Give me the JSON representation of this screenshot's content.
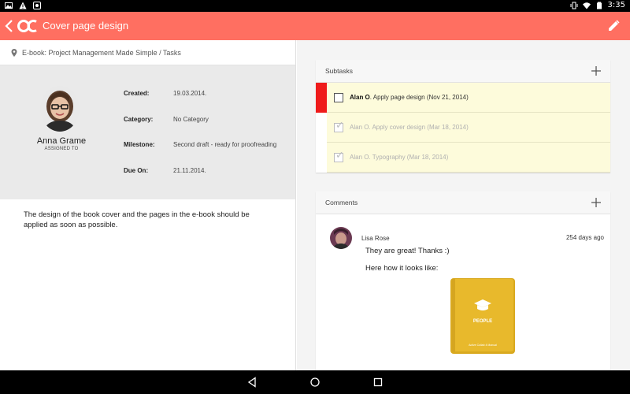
{
  "status_bar": {
    "time": "3:35"
  },
  "app_bar": {
    "title": "Cover page design"
  },
  "breadcrumb": {
    "text": "E-book: Project Management Made Simple / Tasks"
  },
  "assignee": {
    "name": "Anna Grame",
    "role": "ASSIGNED TO"
  },
  "fields": {
    "created_label": "Created:",
    "created_value": "19.03.2014.",
    "category_label": "Category:",
    "category_value": "No Category",
    "milestone_label": "Milestone:",
    "milestone_value": "Second draft - ready for proofreading",
    "due_label": "Due On:",
    "due_value": "21.11.2014."
  },
  "description": "The design of the book cover and the pages in the e-book should be applied as soon as possible.",
  "subtasks": {
    "header": "Subtasks",
    "items": [
      {
        "assignee": "Alan O",
        "text": ". Apply page design (Nov 21, 2014)",
        "done": false
      },
      {
        "assignee": "",
        "text": "Alan O. Apply cover design (Mar 18, 2014)",
        "done": true
      },
      {
        "assignee": "",
        "text": "Alan O. Typography (Mar 18, 2014)",
        "done": true
      }
    ]
  },
  "comments": {
    "header": "Comments",
    "author": "Lisa Rose",
    "time": "254 days ago",
    "line1": "They are great! Thanks :)",
    "line2": "Here how it looks like:",
    "book_title": "PEOPLE",
    "book_subtitle": "Active Collab 4 Manual"
  },
  "colors": {
    "app_bar": "#ff6f61",
    "active_bar": "#ef1b1b",
    "subtask_bg": "#fdfbdb",
    "book": "#e8b92c"
  }
}
